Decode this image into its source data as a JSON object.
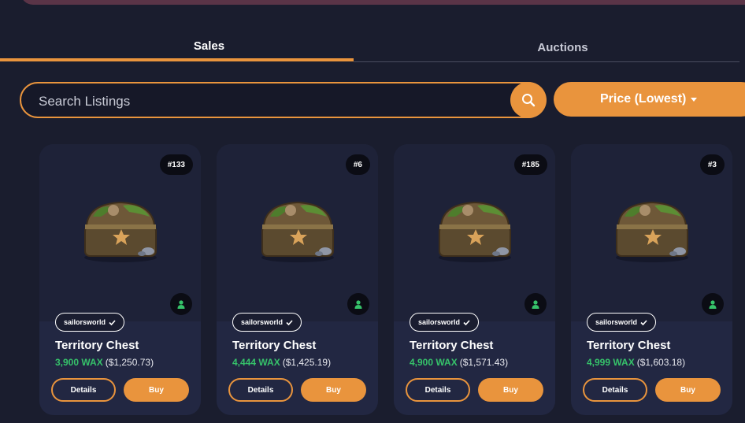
{
  "tabs": [
    {
      "label": "Sales",
      "active": true
    },
    {
      "label": "Auctions",
      "active": false
    }
  ],
  "search": {
    "placeholder": "Search Listings"
  },
  "sort": {
    "label": "Price (Lowest)"
  },
  "colors": {
    "accent": "#e9943d",
    "price_green": "#36c26a",
    "background": "#1a1d2e"
  },
  "cards": [
    {
      "mint": "#133",
      "collection": "sailorsworld",
      "name": "Territory Chest",
      "price_wax": "3,900 WAX",
      "price_usd": "($1,250.73)",
      "details_label": "Details",
      "buy_label": "Buy"
    },
    {
      "mint": "#6",
      "collection": "sailorsworld",
      "name": "Territory Chest",
      "price_wax": "4,444 WAX",
      "price_usd": "($1,425.19)",
      "details_label": "Details",
      "buy_label": "Buy"
    },
    {
      "mint": "#185",
      "collection": "sailorsworld",
      "name": "Territory Chest",
      "price_wax": "4,900 WAX",
      "price_usd": "($1,571.43)",
      "details_label": "Details",
      "buy_label": "Buy"
    },
    {
      "mint": "#3",
      "collection": "sailorsworld",
      "name": "Territory Chest",
      "price_wax": "4,999 WAX",
      "price_usd": "($1,603.18)",
      "details_label": "Details",
      "buy_label": "Buy"
    }
  ]
}
